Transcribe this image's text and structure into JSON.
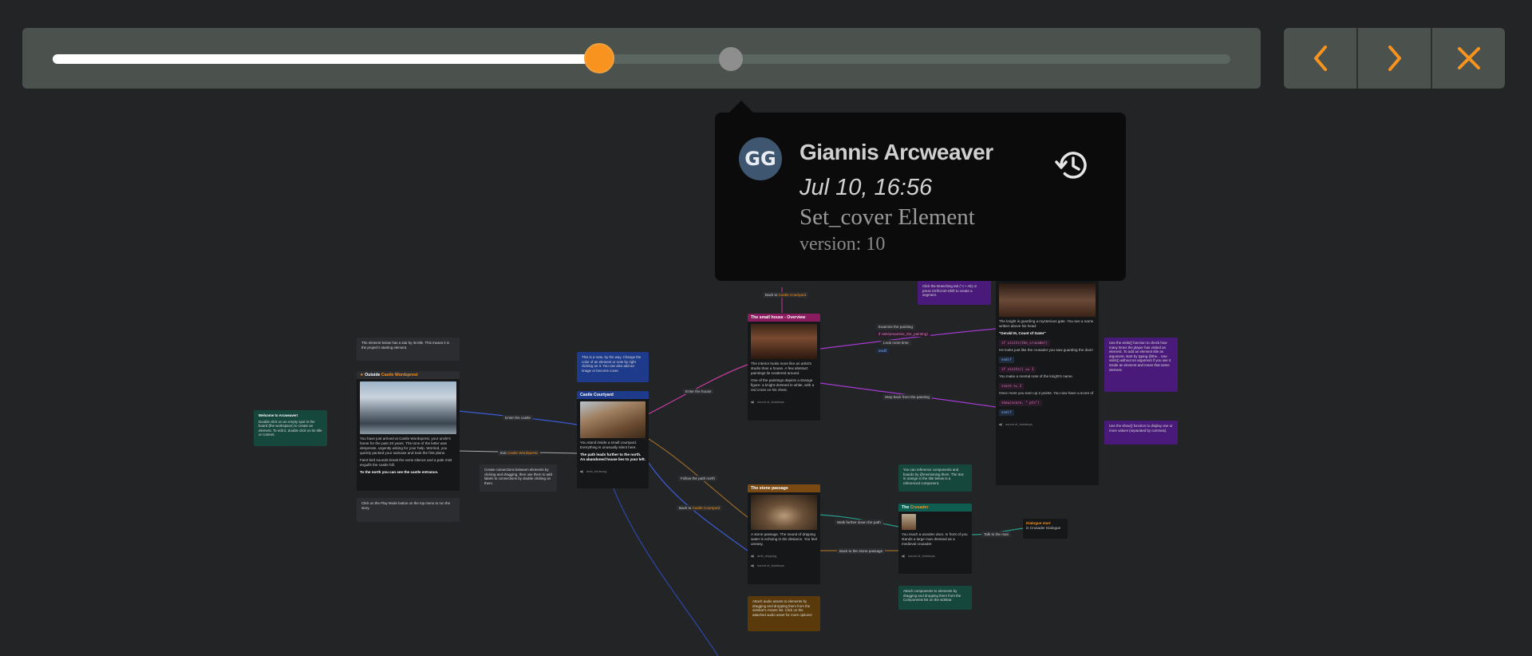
{
  "timeline": {
    "progress": 0.4639,
    "marker_position": 0.5757,
    "colors": {
      "accent": "#f7931e",
      "fill": "#ffffff",
      "track": "#5b6660",
      "bar": "#4b524d"
    }
  },
  "nav": {
    "prev_icon": "chevron-left-icon",
    "next_icon": "chevron-right-icon",
    "close_icon": "close-icon",
    "icon_color": "#f7931e"
  },
  "popup": {
    "avatar_initials": "GG",
    "avatar_color": "#3e5670",
    "user_name": "Giannis Arcweaver",
    "date": "Jul 10, 16:56",
    "action": "Set_cover Element",
    "version": "version: 10",
    "restore_icon": "history-icon"
  },
  "canvas": {
    "welcome": {
      "title": "Welcome to Arcweaver!",
      "text": "Double click on an empty spot in the board (the workspace) to create an element. To edit it, double click on its title or content."
    },
    "notes": {
      "starting": "The element below has a star by its title. This means it is the project's starting element.",
      "play": "Click on the Play Mode button on the top menu to run the story.",
      "note_color": "This is a note, by the way. Change the color of an element or note by right clicking on it. You can also add an image or become cover.",
      "connections": "Create connections between elements by clicking and dragging, then use them to add labels to connections by double clicking on them.",
      "references": "You can reference components and boards by @mentioning them. The text in orange in the title below is a referenced component.",
      "components": "Attach components to elements by dragging and dropping them from the Components list on the sidebar.",
      "audio": "Attach audio assets to elements by dragging and dropping them from the sidebar's Assets list. Click on the attached audio asset for more options!",
      "visits": "Use the visits() function to check how many times the player has visited an element. To add an element title as argument, start by typing @the... Use visits() without an argument if you use it inside an element and mean that same element.",
      "show": "Use the show() function to display one or more values (separated by commas).",
      "branching": "Click the Branching tab (⌥+ Alt) or press Ctrl/Cmd+Shift to create a segment."
    },
    "outside": {
      "title_prefix": "Outside",
      "title_ref": "Castle Wordsprest",
      "p1": "You have just arrived at Castle Wordsprest, your uncle's home for the past 20 years. The tone of the letter was desperate, urgently asking for your help. Worried, you quickly packed your suitcase and took the first plane.",
      "p2": "Faint bird sounds break the eerie silence and a pale mist engulfs the castle hill.",
      "p3": "To the north you can see the castle entrance."
    },
    "courtyard": {
      "title": "Castle Courtyard",
      "p1": "You stand inside a small courtyard. Everything is unusually silent here.",
      "p2": "The path leads further to the north. An abandoned house lies to your left.",
      "audio": "amb_birdsong"
    },
    "house": {
      "title": "The small house - Overview",
      "p1": "The interior looks more like an artist's studio than a house. A few abstract paintings lie scattered around.",
      "p2": "One of the paintings depicts a strange figure: a knight dressed in white, with a red cross on his chest.",
      "audio": "sound of_footsteps"
    },
    "painting": {
      "p1": "The knight is guarding a mysterious gate. You see a name written above his head:",
      "p2": "\"Gerald III, Count of Gater\"",
      "code1": "if visits(the_crusader)",
      "p3": "He looks just like the crusader you saw guarding the door!",
      "code2": "endif",
      "code3": "if visits() == 1",
      "p4": "You make a mental note of the knight's name.",
      "code4": "score += 2",
      "p5": "Once more you earn up 2 points. You now have a score of",
      "code5": "show(score, \" pts\")",
      "code6": "endif",
      "audio": "sound of_footsteps"
    },
    "passage": {
      "title": "The stone passage",
      "p1": "A stone passage. The sound of dripping water is echoing in the distance. You feel uneasy.",
      "audio1": "amb_dripping",
      "audio2": "sound of_footsteps"
    },
    "crusader": {
      "title_prefix": "The",
      "title_ref": "Crusader",
      "p1": "You reach a wooden door. In front of you stands a large man dressed as a medieval crusader.",
      "audio": "sound of_footsteps"
    },
    "dialogue": {
      "title": "Dialogue start",
      "sub": "in Crusader Dialogue"
    },
    "labels": {
      "enter_castle": "Enter the castle",
      "exit_castle": "Exit",
      "exit_castle_ref": "Castle Wordsprest",
      "enter_house": "Enter the house",
      "follow_path": "Follow the path north",
      "back_to": "Back to",
      "back_courtyard_ref": "Castle Courtyard",
      "examine": "Examine the painting",
      "examine_code": "if visits(examine_the_painting)",
      "look_again": "Look more time",
      "step_back": "Step back from the painting",
      "walk_further": "Walk further down the path",
      "back_passage": "Back to the stone passage",
      "talk_man": "Talk to the man",
      "back_top": "Back to",
      "back_top_ref": "Castle Courtyard",
      "endif_small": "endif"
    }
  }
}
